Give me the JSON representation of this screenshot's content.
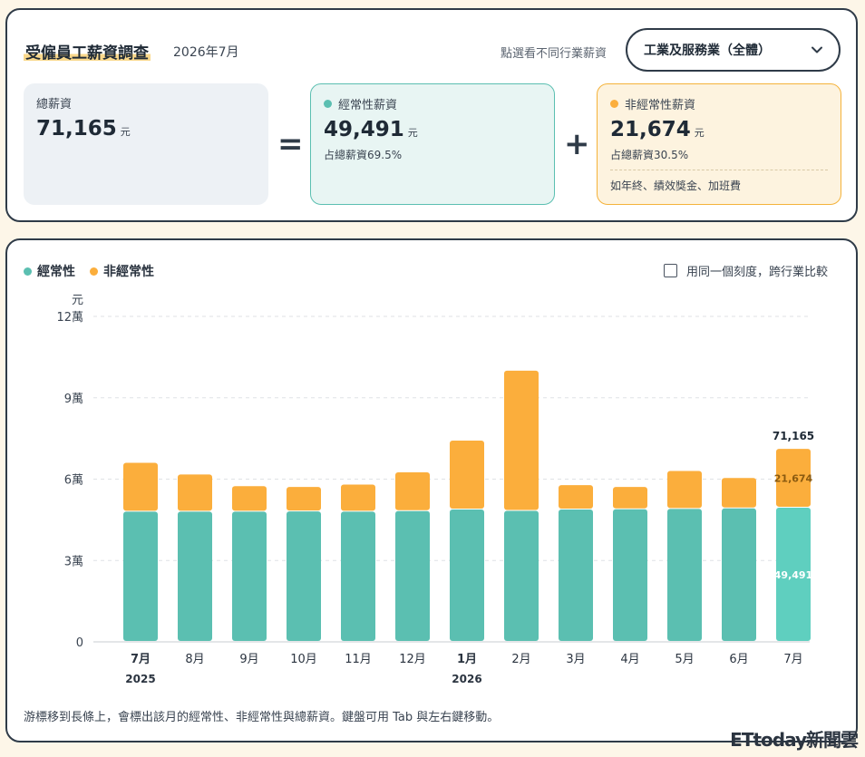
{
  "header": {
    "title": "受僱員工薪資調查",
    "subtitle": "2026年7月",
    "hint": "點選看不同行業薪資",
    "industry_selected": "工業及服務業（全體）"
  },
  "cards": {
    "total": {
      "label": "總薪資",
      "value": "71,165",
      "unit": "元"
    },
    "regular": {
      "label": "經常性薪資",
      "value": "49,491",
      "unit": "元",
      "share": "占總薪資69.5%"
    },
    "nonregular": {
      "label": "非經常性薪資",
      "value": "21,674",
      "unit": "元",
      "share": "占總薪資30.5%",
      "note": "如年終、績效獎金、加班費"
    }
  },
  "operators": {
    "equals": "=",
    "plus": "+"
  },
  "controls": {
    "same_scale_label": "用同一個刻度，跨行業比較"
  },
  "footnote": "游標移到長條上，會標出該月的經常性、非經常性與總薪資。鍵盤可用 Tab 與左右鍵移動。",
  "watermark": "ETtoday新聞雲",
  "colors": {
    "regular": "#5bbfb1",
    "nonregular": "#fbae3c",
    "regular_highlight": "#5fcfbf"
  },
  "chart_data": {
    "type": "bar",
    "stacked": true,
    "y_unit_label": "元",
    "y_ticks": [
      "0",
      "3萬",
      "6萬",
      "9萬",
      "12萬"
    ],
    "ylim": [
      0,
      120000
    ],
    "grid": true,
    "legend_position": "top-left",
    "categories": [
      "7月",
      "8月",
      "9月",
      "10月",
      "11月",
      "12月",
      "1月",
      "2月",
      "3月",
      "4月",
      "5月",
      "6月",
      "7月"
    ],
    "year_labels": [
      {
        "index": 0,
        "label": "2025"
      },
      {
        "index": 6,
        "label": "2026"
      }
    ],
    "series": [
      {
        "name": "經常性",
        "values": [
          48000,
          48000,
          48000,
          48100,
          48000,
          48200,
          48800,
          48300,
          48800,
          48900,
          49000,
          49200,
          49491
        ]
      },
      {
        "name": "非經常性",
        "values": [
          18000,
          13700,
          9400,
          9000,
          10000,
          14300,
          25400,
          51700,
          9000,
          8200,
          14000,
          11200,
          21674
        ]
      }
    ],
    "highlight_index": 12,
    "highlight_labels": {
      "total": "71,165",
      "nonregular": "21,674",
      "regular": "49,491"
    }
  }
}
